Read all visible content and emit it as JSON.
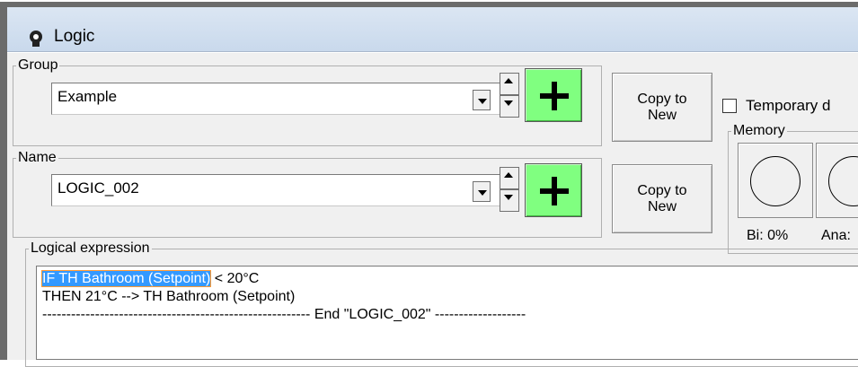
{
  "window": {
    "title": "Logic",
    "icon": "logic-app-icon"
  },
  "group": {
    "label": "Group",
    "selected": "Example",
    "copy_label": "Copy to\nNew"
  },
  "name": {
    "label": "Name",
    "selected": "LOGIC_002",
    "copy_label": "Copy to\nNew"
  },
  "temporary": {
    "label": "Temporary d"
  },
  "memory": {
    "label": "Memory",
    "bi": "Bi: 0%",
    "ana": "Ana:"
  },
  "expression": {
    "label": "Logical expression",
    "line1_selected": "IF TH Bathroom (Setpoint)",
    "line1_rest": " < 20°C",
    "line2": "THEN 21°C --> TH Bathroom (Setpoint)",
    "line3": "-------------------------------------------------------- End \"LOGIC_002\" -------------------"
  },
  "colors": {
    "add_button": "#80ff80",
    "selection": "#3399ff",
    "titlebar": "#d4e1f1"
  }
}
